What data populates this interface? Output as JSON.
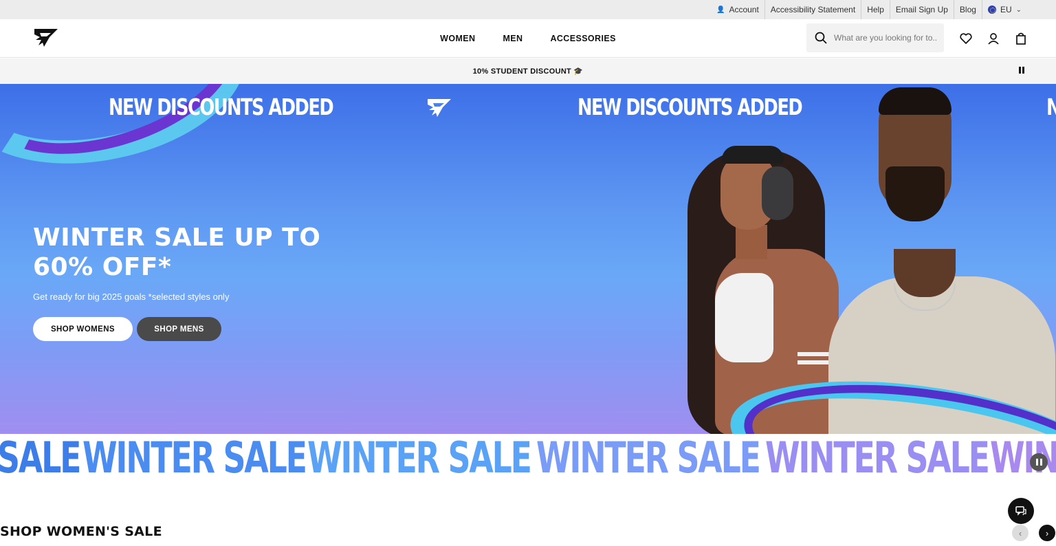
{
  "utility": {
    "account": "Account",
    "accessibility": "Accessibility Statement",
    "help": "Help",
    "email_signup": "Email Sign Up",
    "blog": "Blog",
    "region": "EU"
  },
  "header": {
    "logo_icon": "gymshark-logo-icon",
    "nav": [
      "WOMEN",
      "MEN",
      "ACCESSORIES"
    ],
    "search_placeholder": "What are you looking for to...",
    "icons": [
      "search-icon",
      "heart-icon",
      "user-icon",
      "bag-icon"
    ]
  },
  "promo": {
    "text": "10% STUDENT DISCOUNT 🎓"
  },
  "hero": {
    "banner": [
      "NEW DISCOUNTS ADDED",
      "NEW DISCOUNTS ADDED",
      "N"
    ],
    "title": "WINTER SALE UP TO 60% OFF*",
    "subtitle": "Get ready for big 2025 goals *selected styles only",
    "buttons": {
      "women": "SHOP WOMENS",
      "men": "SHOP MENS"
    }
  },
  "ticker": {
    "items": [
      "SALE",
      "WINTER SALE",
      "WINTER SALE",
      "WINTER SALE",
      "WINTER SALE",
      "WINT"
    ],
    "colors": [
      "#3d7de8",
      "#4a8cf0",
      "#5aa2f5",
      "#7a9cf6",
      "#9a8ef2",
      "#a88aef"
    ]
  },
  "section": {
    "title": "SHOP WOMEN'S SALE",
    "prev": "‹",
    "next": "›"
  },
  "colors": {
    "accent": "#111111",
    "hero_top": "#3d6fe8",
    "hero_bottom": "#a08ef0"
  }
}
